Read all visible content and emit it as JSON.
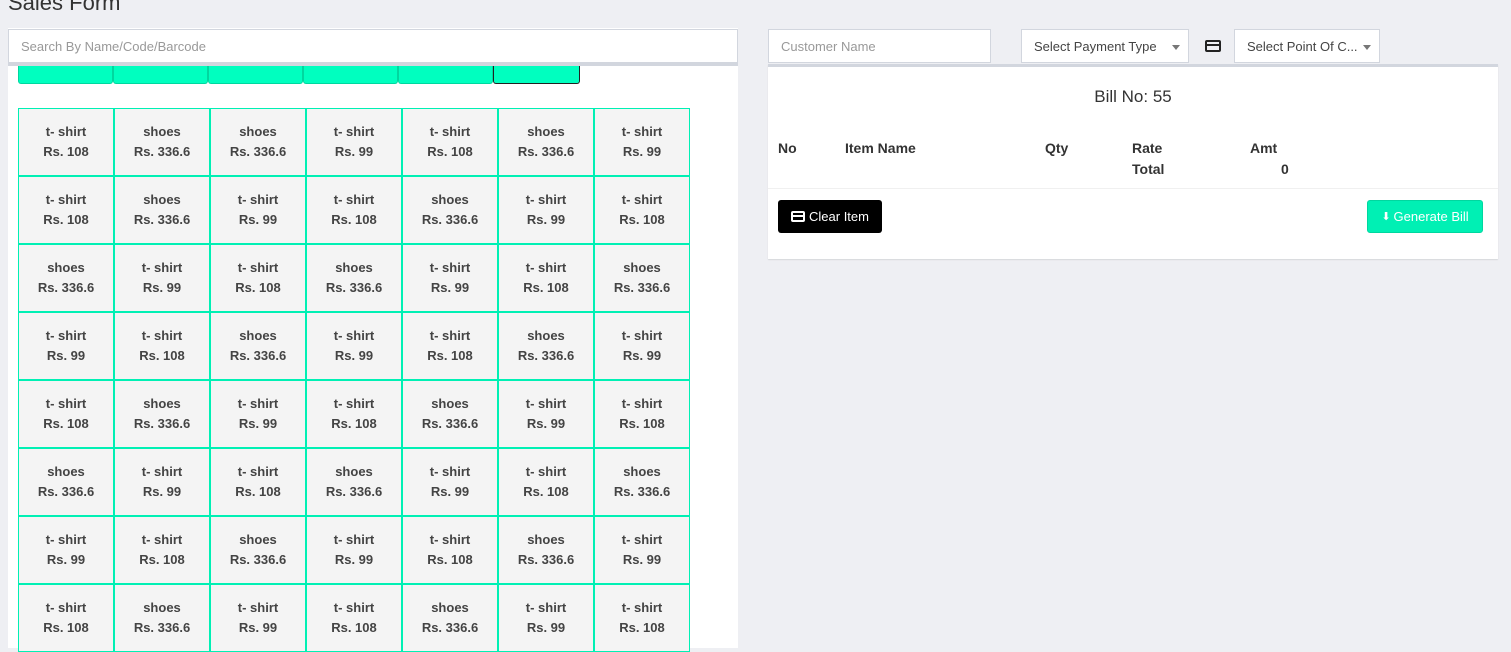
{
  "page": {
    "title": "Sales Form"
  },
  "search": {
    "placeholder": "Search By Name/Code/Barcode"
  },
  "customer": {
    "placeholder": "Customer Name"
  },
  "payment": {
    "selected": "Select Payment Type"
  },
  "point_of_sale": {
    "selected": "Select Point Of C..."
  },
  "bill": {
    "bill_no": "Bill No: 55",
    "headers": {
      "no": "No",
      "item_name": "Item Name",
      "qty": "Qty",
      "rate": "Rate",
      "amt": "Amt"
    },
    "total_label": "Total",
    "total_value": "0",
    "clear_label": "Clear Item",
    "generate_label": "Generate Bill"
  },
  "colors": {
    "accent": "#00f0b4",
    "tile_bg": "#f4f4f4",
    "dark_button": "#000000"
  },
  "icons": {
    "card": "credit-card-icon",
    "download": "download-icon"
  },
  "products": [
    [
      [
        "t- shirt",
        "Rs. 108"
      ],
      [
        "shoes",
        "Rs. 336.6"
      ],
      [
        "shoes",
        "Rs. 336.6"
      ],
      [
        "t- shirt",
        "Rs. 99"
      ],
      [
        "t- shirt",
        "Rs. 108"
      ],
      [
        "shoes",
        "Rs. 336.6"
      ],
      [
        "t- shirt",
        "Rs. 99"
      ]
    ],
    [
      [
        "t- shirt",
        "Rs. 108"
      ],
      [
        "shoes",
        "Rs. 336.6"
      ],
      [
        "t- shirt",
        "Rs. 99"
      ],
      [
        "t- shirt",
        "Rs. 108"
      ],
      [
        "shoes",
        "Rs. 336.6"
      ],
      [
        "t- shirt",
        "Rs. 99"
      ],
      [
        "t- shirt",
        "Rs. 108"
      ]
    ],
    [
      [
        "shoes",
        "Rs. 336.6"
      ],
      [
        "t- shirt",
        "Rs. 99"
      ],
      [
        "t- shirt",
        "Rs. 108"
      ],
      [
        "shoes",
        "Rs. 336.6"
      ],
      [
        "t- shirt",
        "Rs. 99"
      ],
      [
        "t- shirt",
        "Rs. 108"
      ],
      [
        "shoes",
        "Rs. 336.6"
      ]
    ],
    [
      [
        "t- shirt",
        "Rs. 99"
      ],
      [
        "t- shirt",
        "Rs. 108"
      ],
      [
        "shoes",
        "Rs. 336.6"
      ],
      [
        "t- shirt",
        "Rs. 99"
      ],
      [
        "t- shirt",
        "Rs. 108"
      ],
      [
        "shoes",
        "Rs. 336.6"
      ],
      [
        "t- shirt",
        "Rs. 99"
      ]
    ],
    [
      [
        "t- shirt",
        "Rs. 108"
      ],
      [
        "shoes",
        "Rs. 336.6"
      ],
      [
        "t- shirt",
        "Rs. 99"
      ],
      [
        "t- shirt",
        "Rs. 108"
      ],
      [
        "shoes",
        "Rs. 336.6"
      ],
      [
        "t- shirt",
        "Rs. 99"
      ],
      [
        "t- shirt",
        "Rs. 108"
      ]
    ],
    [
      [
        "shoes",
        "Rs. 336.6"
      ],
      [
        "t- shirt",
        "Rs. 99"
      ],
      [
        "t- shirt",
        "Rs. 108"
      ],
      [
        "shoes",
        "Rs. 336.6"
      ],
      [
        "t- shirt",
        "Rs. 99"
      ],
      [
        "t- shirt",
        "Rs. 108"
      ],
      [
        "shoes",
        "Rs. 336.6"
      ]
    ],
    [
      [
        "t- shirt",
        "Rs. 99"
      ],
      [
        "t- shirt",
        "Rs. 108"
      ],
      [
        "shoes",
        "Rs. 336.6"
      ],
      [
        "t- shirt",
        "Rs. 99"
      ],
      [
        "t- shirt",
        "Rs. 108"
      ],
      [
        "shoes",
        "Rs. 336.6"
      ],
      [
        "t- shirt",
        "Rs. 99"
      ]
    ],
    [
      [
        "t- shirt",
        "Rs. 108"
      ],
      [
        "shoes",
        "Rs. 336.6"
      ],
      [
        "t- shirt",
        "Rs. 99"
      ],
      [
        "t- shirt",
        "Rs. 108"
      ],
      [
        "shoes",
        "Rs. 336.6"
      ],
      [
        "t- shirt",
        "Rs. 99"
      ],
      [
        "t- shirt",
        "Rs. 108"
      ]
    ]
  ]
}
